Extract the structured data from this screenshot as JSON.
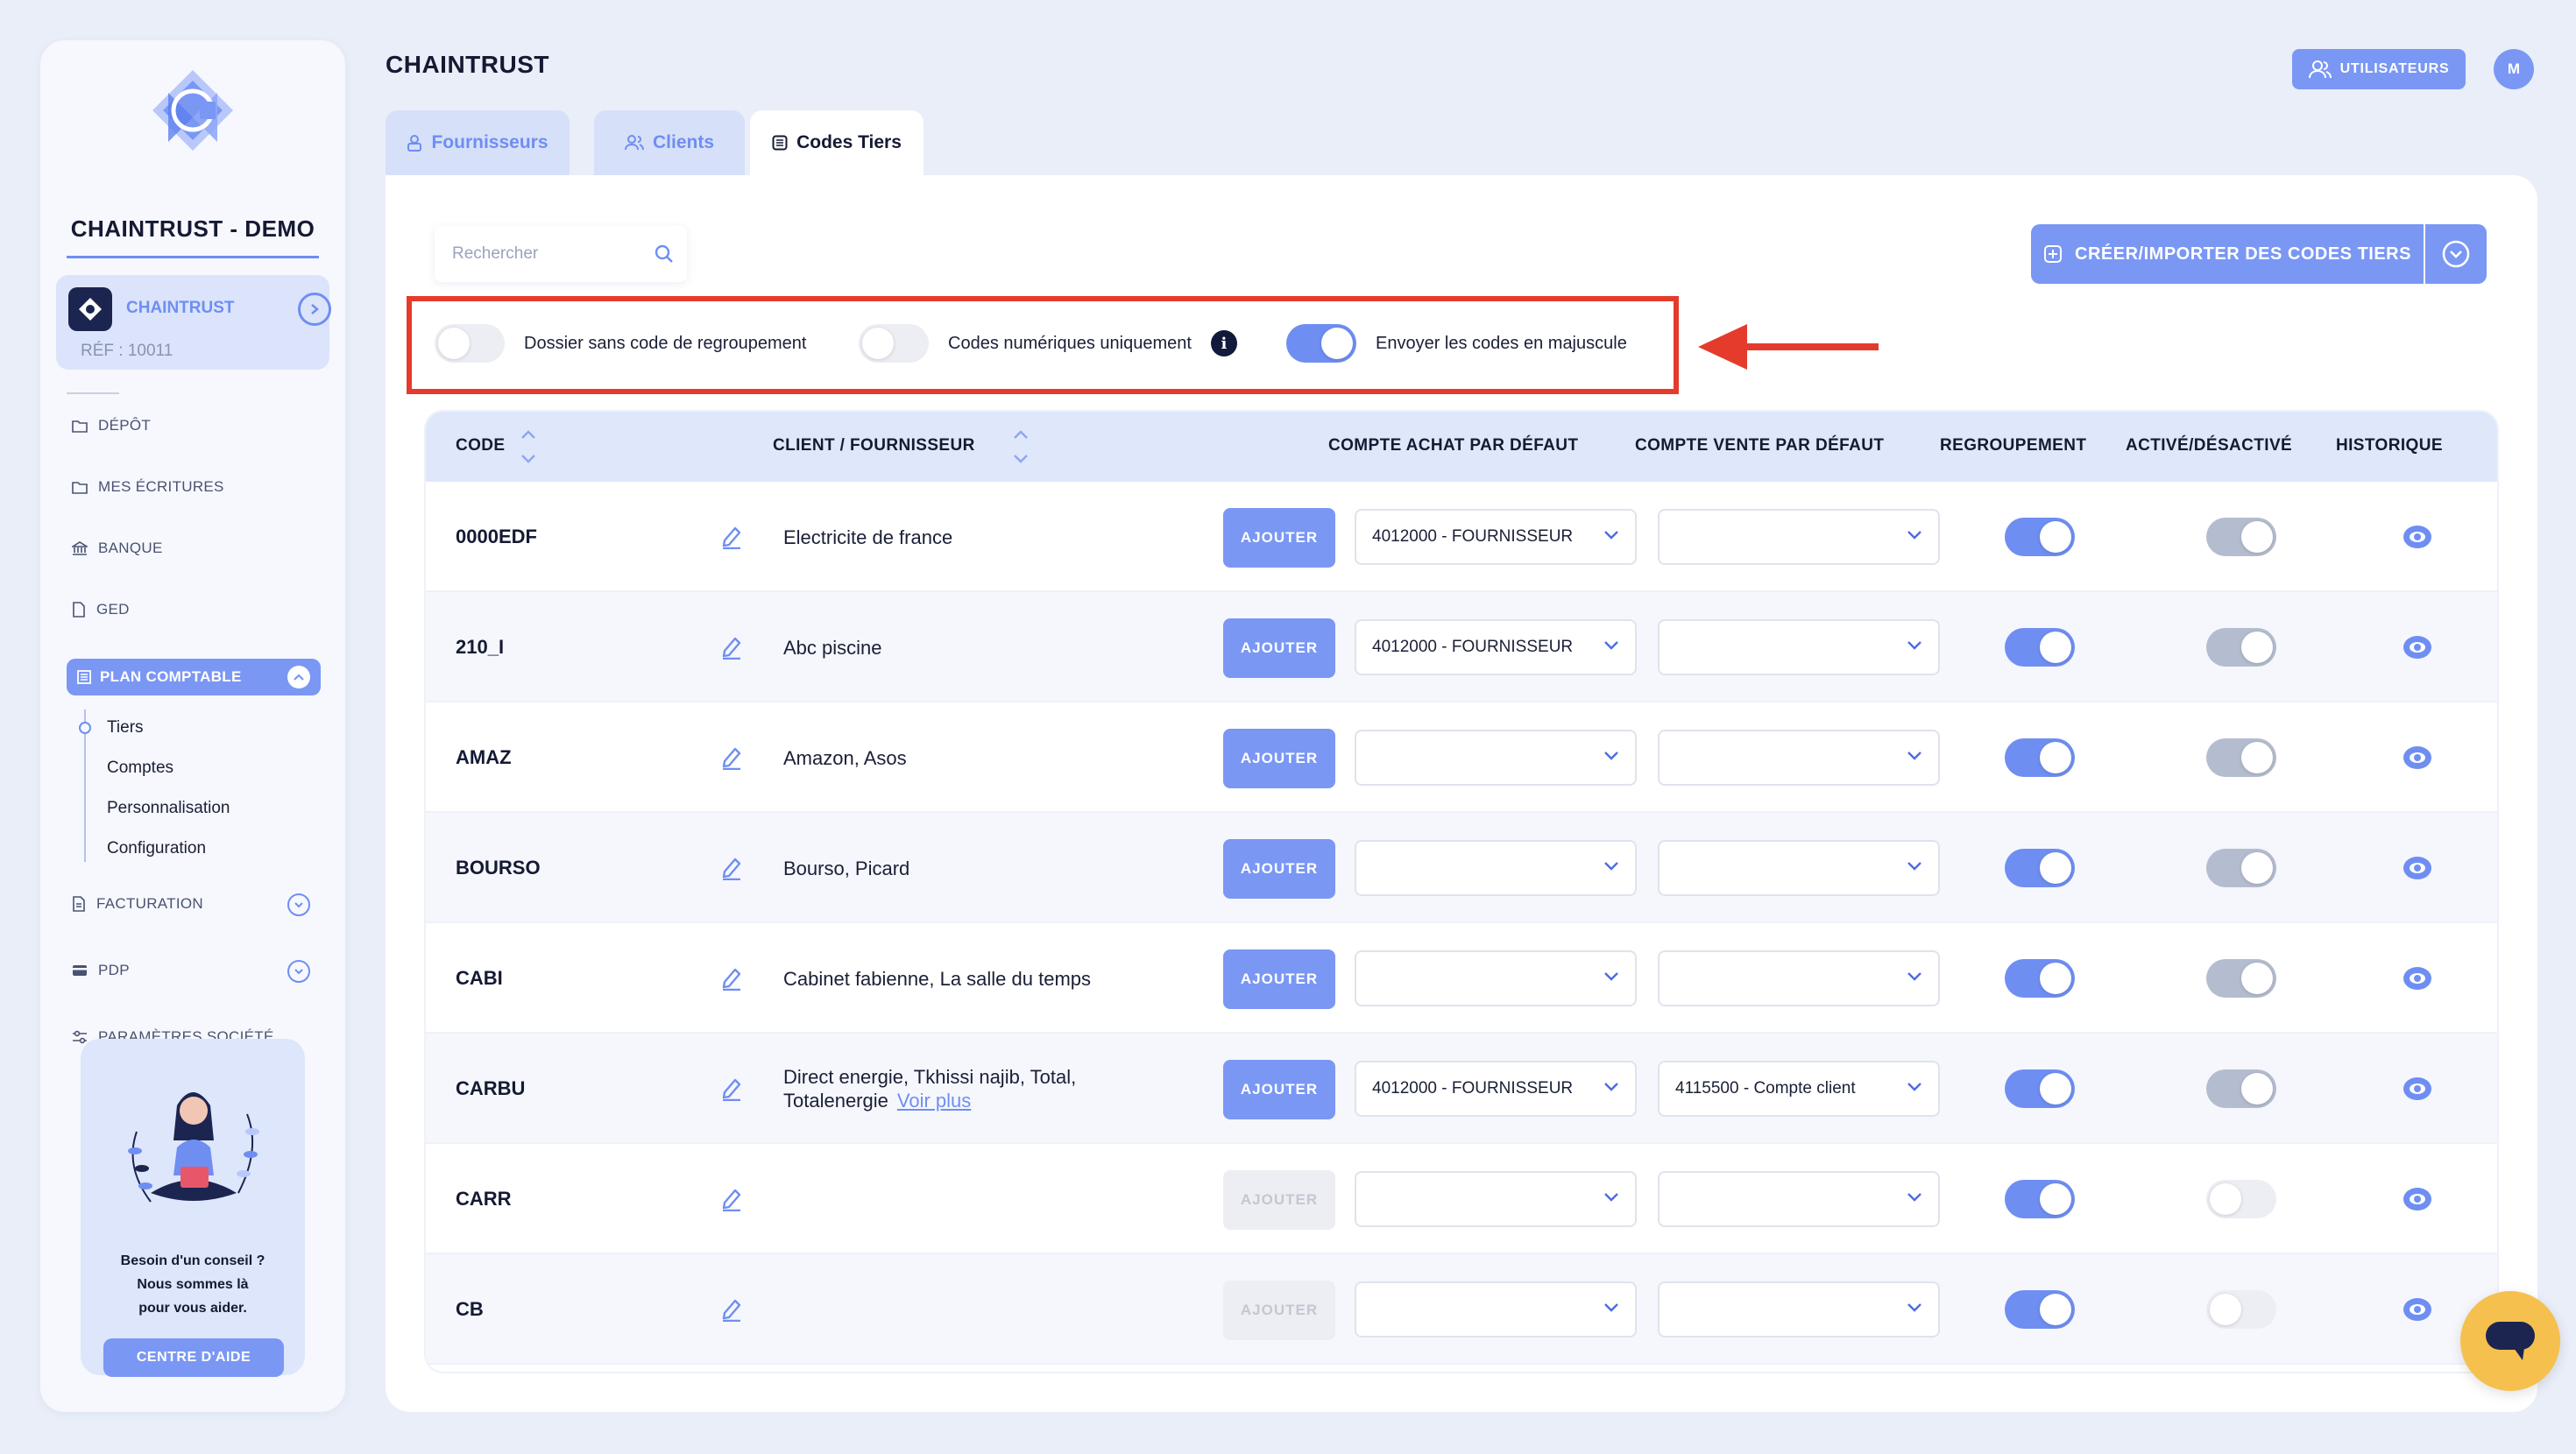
{
  "sidebar": {
    "brand": "CHAINTRUST - DEMO",
    "company": {
      "name": "CHAINTRUST",
      "ref": "RÉF : 10011"
    },
    "nav": [
      {
        "label": "DÉPÔT",
        "icon": "folder-icon"
      },
      {
        "label": "MES ÉCRITURES",
        "icon": "folder-icon"
      },
      {
        "label": "BANQUE",
        "icon": "bank-icon"
      },
      {
        "label": "GED",
        "icon": "document-icon"
      }
    ],
    "active_section": "PLAN COMPTABLE",
    "subnav": [
      "Tiers",
      "Comptes",
      "Personnalisation",
      "Configuration"
    ],
    "nav_after": [
      {
        "label": "FACTURATION",
        "icon": "invoice-icon"
      },
      {
        "label": "PDP",
        "icon": "card-icon"
      },
      {
        "label": "PARAMÈTRES SOCIÉTÉ",
        "icon": "sliders-icon"
      }
    ],
    "help": {
      "line1": "Besoin d'un conseil ?",
      "line2": "Nous sommes là",
      "line3": "pour vous aider.",
      "button": "CENTRE D'AIDE"
    }
  },
  "header": {
    "title": "CHAINTRUST",
    "users_button": "UTILISATEURS",
    "avatar_initial": "M"
  },
  "tabs": [
    {
      "label": "Fournisseurs",
      "active": false
    },
    {
      "label": "Clients",
      "active": false
    },
    {
      "label": "Codes Tiers",
      "active": true
    }
  ],
  "toolbar": {
    "search_placeholder": "Rechercher",
    "create_button": "CRÉER/IMPORTER DES CODES TIERS"
  },
  "options": [
    {
      "label": "Dossier sans code de regroupement",
      "enabled": false
    },
    {
      "label": "Codes numériques uniquement",
      "enabled": false,
      "info": "i"
    },
    {
      "label": "Envoyer les codes en majuscule",
      "enabled": true
    }
  ],
  "colors": {
    "accent": "#7a97f4",
    "highlight": "#e53b2d",
    "chat": "#f6c04f"
  },
  "table": {
    "columns": {
      "code": "CODE",
      "tiers": "CLIENT / FOURNISSEUR",
      "achat": "COMPTE ACHAT PAR DÉFAUT",
      "vente": "COMPTE VENTE PAR DÉFAUT",
      "regroupement": "REGROUPEMENT",
      "active": "ACTIVÉ/DÉSACTIVÉ",
      "historique": "HISTORIQUE"
    },
    "add_label": "AJOUTER",
    "more_label": "Voir plus",
    "rows": [
      {
        "code": "0000EDF",
        "tiers": "Electricite de france",
        "more": false,
        "add_enabled": true,
        "achat": "4012000 - FOURNISSEUR",
        "vente": "",
        "regroupement": true,
        "active": true
      },
      {
        "code": "210_I",
        "tiers": "Abc piscine",
        "more": false,
        "add_enabled": true,
        "achat": "4012000 - FOURNISSEUR",
        "vente": "",
        "regroupement": true,
        "active": true
      },
      {
        "code": "AMAZ",
        "tiers": "Amazon, Asos",
        "more": false,
        "add_enabled": true,
        "achat": "",
        "vente": "",
        "regroupement": true,
        "active": true
      },
      {
        "code": "BOURSO",
        "tiers": "Bourso, Picard",
        "more": false,
        "add_enabled": true,
        "achat": "",
        "vente": "",
        "regroupement": true,
        "active": true
      },
      {
        "code": "CABI",
        "tiers": "Cabinet fabienne, La salle du temps",
        "more": false,
        "add_enabled": true,
        "achat": "",
        "vente": "",
        "regroupement": true,
        "active": true
      },
      {
        "code": "CARBU",
        "tiers": "Direct energie, Tkhissi najib, Total, Totalenergie",
        "more": true,
        "add_enabled": true,
        "achat": "4012000 - FOURNISSEUR",
        "vente": "4115500 - Compte client",
        "regroupement": true,
        "active": true
      },
      {
        "code": "CARR",
        "tiers": "",
        "more": false,
        "add_enabled": false,
        "achat": "",
        "vente": "",
        "regroupement": true,
        "active": false
      },
      {
        "code": "CB",
        "tiers": "",
        "more": false,
        "add_enabled": false,
        "achat": "",
        "vente": "",
        "regroupement": true,
        "active": false
      }
    ]
  }
}
